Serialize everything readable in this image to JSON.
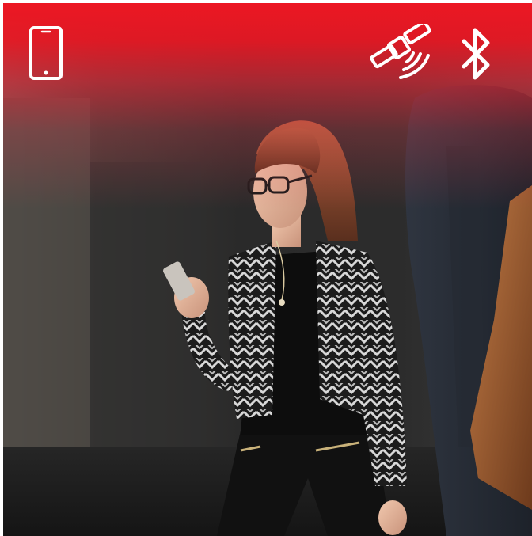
{
  "image": {
    "alt": "",
    "colors": {
      "brand_red": "#EC1723",
      "icon_white": "#FFFFFF"
    }
  },
  "header": {
    "icons": [
      {
        "name": "smartphone-icon"
      },
      {
        "name": "satellite-signal-icon"
      },
      {
        "name": "bluetooth-icon"
      }
    ]
  }
}
